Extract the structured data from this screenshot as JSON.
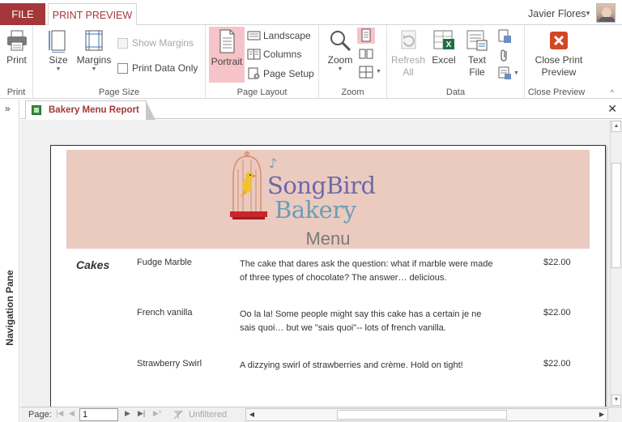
{
  "tabs": {
    "file": "FILE",
    "print_preview": "PRINT PREVIEW"
  },
  "user": {
    "name": "Javier Flores"
  },
  "ribbon": {
    "print": {
      "print": "Print",
      "group": "Print"
    },
    "page_size": {
      "size": "Size",
      "margins": "Margins",
      "show_margins": "Show Margins",
      "print_data_only": "Print Data Only",
      "group": "Page Size"
    },
    "page_layout": {
      "portrait": "Portrait",
      "landscape": "Landscape",
      "columns": "Columns",
      "page_setup": "Page Setup",
      "group": "Page Layout"
    },
    "zoom": {
      "zoom": "Zoom",
      "group": "Zoom"
    },
    "data": {
      "refresh_all_1": "Refresh",
      "refresh_all_2": "All",
      "excel": "Excel",
      "text_file_1": "Text",
      "text_file_2": "File",
      "group": "Data"
    },
    "close_preview": {
      "close_1": "Close Print",
      "close_2": "Preview",
      "group": "Close Preview"
    }
  },
  "nav_pane": {
    "label": "Navigation Pane"
  },
  "document": {
    "tab_label": "Bakery Menu Report",
    "logo_word1": "SongBird",
    "logo_word2": "Bakery",
    "menu_title": "Menu",
    "category": "Cakes",
    "items": [
      {
        "name": "Fudge Marble",
        "description": "The cake that dares ask the question: what if marble were made of three types of chocolate? The answer… delicious.",
        "price": "$22.00"
      },
      {
        "name": "French vanilla",
        "description": "Oo la la! Some people might say this cake has a certain je ne sais quoi… but we \"sais quoi\"-- lots of french vanilla.",
        "price": "$22.00"
      },
      {
        "name": "Strawberry Swirl",
        "description": "A dizzying swirl of strawberries and crème. Hold on tight!",
        "price": "$22.00"
      }
    ]
  },
  "navbar": {
    "page_label": "Page:",
    "page_value": "1",
    "filter": "Unfiltered"
  },
  "colors": {
    "accent": "#a4373a",
    "header_band": "#ebcac0",
    "portrait_active": "#f6c4c8"
  }
}
